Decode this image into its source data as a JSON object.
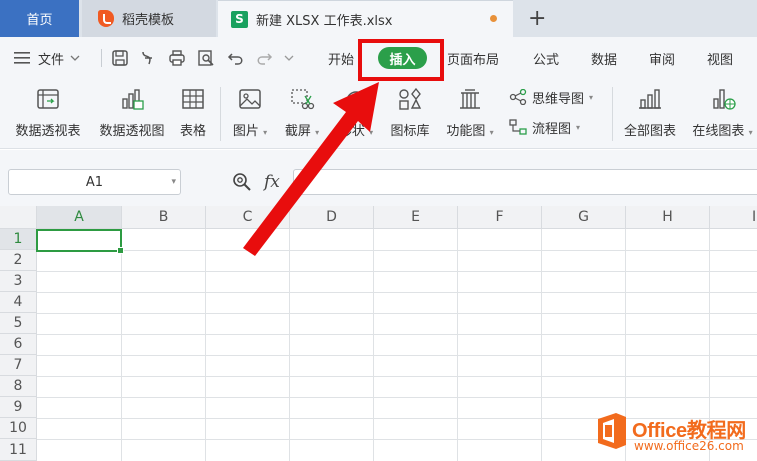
{
  "tabs": {
    "home": "首页",
    "template": "稻壳模板",
    "file": "新建 XLSX 工作表.xlsx",
    "file_logo": "S",
    "add": "+"
  },
  "menu": {
    "file": "文件",
    "items": [
      "开始",
      "插入",
      "页面布局",
      "公式",
      "数据",
      "审阅",
      "视图"
    ],
    "active": "插入",
    "start_visible": "开始"
  },
  "ribbon": {
    "pivot_table": "数据透视表",
    "pivot_chart": "数据透视图",
    "table": "表格",
    "picture": "图片",
    "screenshot": "截屏",
    "shape": "形状",
    "icon_lib": "图标库",
    "func_chart": "功能图",
    "mindmap": "思维导图",
    "flowchart": "流程图",
    "all_charts": "全部图表",
    "online_charts": "在线图表"
  },
  "formula_bar": {
    "cell_ref": "A1",
    "fx_label": "fx",
    "value": ""
  },
  "grid": {
    "columns": [
      "A",
      "B",
      "C",
      "D",
      "E",
      "F",
      "G",
      "H",
      "I"
    ],
    "rows": [
      "1",
      "2",
      "3",
      "4",
      "5",
      "6",
      "7",
      "8",
      "9",
      "10",
      "11"
    ],
    "active_cell": "A1"
  },
  "watermark": {
    "title": "Office教程网",
    "url": "www.office26.com"
  },
  "colors": {
    "accent_green": "#2b9f4a",
    "highlight_red": "#e80d0d",
    "home_tab_blue": "#3b71c2",
    "watermark_orange": "#f26b1d"
  }
}
